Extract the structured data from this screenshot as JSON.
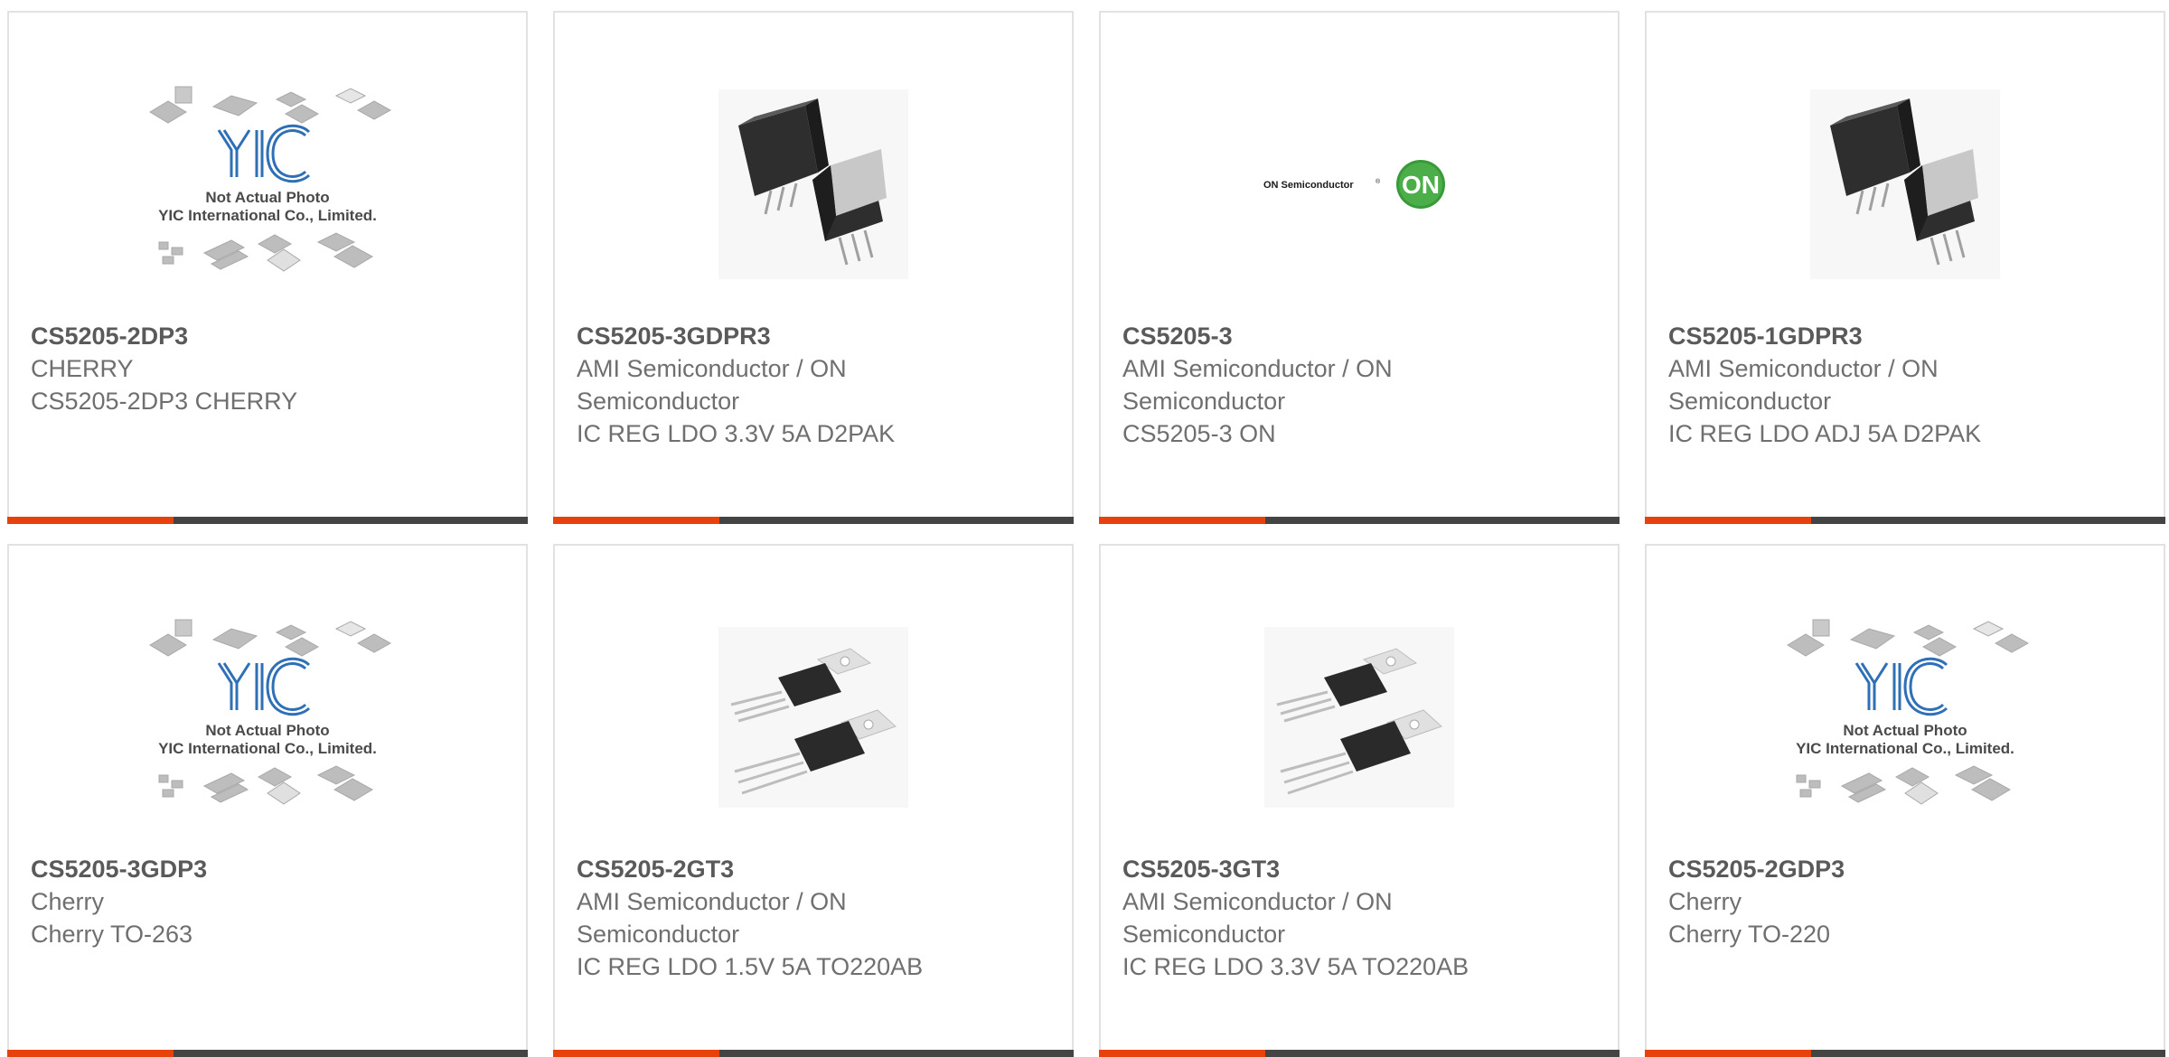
{
  "colors": {
    "accent": "#e8420c",
    "bar": "#444444",
    "text": "#6f6f6f",
    "border": "#e2e2e2"
  },
  "placeholder": {
    "logo_text": "YIC",
    "line1": "Not Actual Photo",
    "line2": "YIC International Co., Limited."
  },
  "onsemi_logo": {
    "wordmark": "ON Semiconductor",
    "registered": "®",
    "badge": "ON"
  },
  "products": [
    {
      "part": "CS5205-2DP3",
      "maker": "CHERRY",
      "maker2": "",
      "desc": "CS5205-2DP3 CHERRY",
      "image": "yic-placeholder-icon"
    },
    {
      "part": "CS5205-3GDPR3",
      "maker": "AMI Semiconductor / ON",
      "maker2": "Semiconductor",
      "desc": "IC REG LDO 3.3V 5A D2PAK",
      "image": "d2pak-package-icon"
    },
    {
      "part": "CS5205-3",
      "maker": "AMI Semiconductor / ON",
      "maker2": "Semiconductor",
      "desc": "CS5205-3 ON",
      "image": "onsemi-logo-icon"
    },
    {
      "part": "CS5205-1GDPR3",
      "maker": "AMI Semiconductor / ON",
      "maker2": "Semiconductor",
      "desc": "IC REG LDO ADJ 5A D2PAK",
      "image": "d2pak-package-icon"
    },
    {
      "part": "CS5205-3GDP3",
      "maker": "Cherry",
      "maker2": "",
      "desc": "Cherry TO-263",
      "image": "yic-placeholder-icon"
    },
    {
      "part": "CS5205-2GT3",
      "maker": "AMI Semiconductor / ON",
      "maker2": "Semiconductor",
      "desc": "IC REG LDO 1.5V 5A TO220AB",
      "image": "to220-package-icon"
    },
    {
      "part": "CS5205-3GT3",
      "maker": "AMI Semiconductor / ON",
      "maker2": "Semiconductor",
      "desc": "IC REG LDO 3.3V 5A TO220AB",
      "image": "to220-package-icon"
    },
    {
      "part": "CS5205-2GDP3",
      "maker": "Cherry",
      "maker2": "",
      "desc": "Cherry TO-220",
      "image": "yic-placeholder-icon"
    }
  ]
}
